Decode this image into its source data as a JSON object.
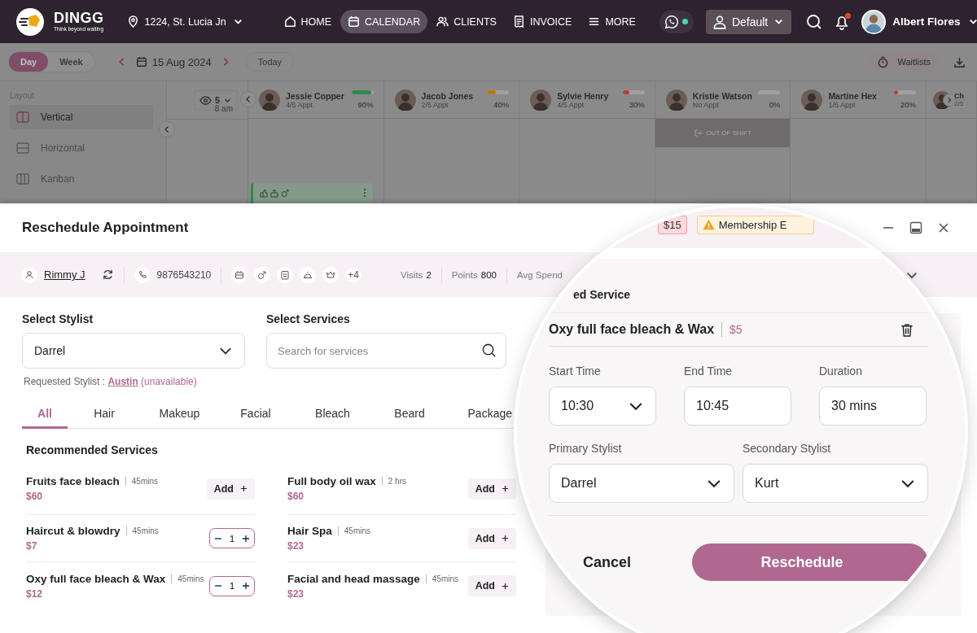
{
  "nav": {
    "brand": "DINGG",
    "tagline": "Think beyond waiting",
    "location": "1224, St. Lucia Jn",
    "items": [
      {
        "label": "HOME",
        "selected": false
      },
      {
        "label": "CALENDAR",
        "selected": true
      },
      {
        "label": "CLIENTS",
        "selected": false
      },
      {
        "label": "INVOICE",
        "selected": false
      },
      {
        "label": "MORE",
        "selected": false
      }
    ],
    "whatsapp_online": true,
    "profile": "Default",
    "notification_dot": true,
    "user": "Albert Flores"
  },
  "calendar": {
    "views": [
      {
        "label": "Day",
        "selected": true
      },
      {
        "label": "Week",
        "selected": false
      }
    ],
    "date": "15 Aug 2024",
    "today": "Today",
    "waitlists": "Waitlists",
    "layout_title": "Layout",
    "layouts": [
      {
        "label": "Vertical",
        "selected": true
      },
      {
        "label": "Horizontal",
        "selected": false
      },
      {
        "label": "Kanban",
        "selected": false
      }
    ],
    "visible_count": "5",
    "time": "8 am",
    "stylists": [
      {
        "name": "Jessie Copper",
        "appts": "4/5 Appt",
        "level": 0.9,
        "percent": "90%",
        "color": "#2f8a4a",
        "appointment": true
      },
      {
        "name": "Jacob Jones",
        "appts": "2/5 Appt",
        "level": 0.4,
        "percent": "40%",
        "color": "#b07a1a"
      },
      {
        "name": "Sylvie Henry",
        "appts": "4/5 Appt",
        "level": 0.3,
        "percent": "30%",
        "color": "#b5402c"
      },
      {
        "name": "Kristie Watson",
        "appts": "No Appt",
        "percent": "0%",
        "out_of_shift": "OUT OF SHIFT"
      },
      {
        "name": "Martine Hex",
        "appts": "1/5 Appt",
        "level": 0.2,
        "percent": "20%",
        "color": "#b5402c"
      },
      {
        "name": "Ch",
        "appts": "2/5"
      }
    ]
  },
  "modal": {
    "title": "Reschedule Appointment",
    "client": {
      "name": "Rimmy J",
      "phone": "9876543210",
      "extra": "+4",
      "stats": [
        {
          "label": "Visits",
          "value": "2"
        },
        {
          "label": "Points",
          "value": "800"
        },
        {
          "label": "Avg Spend"
        }
      ]
    },
    "stylist_label": "Select Stylist",
    "stylist": "Darrel",
    "services_label": "Select Services",
    "search_placeholder": "Search for services",
    "requested_label": "Requested Stylist :",
    "requested_name": "Austin",
    "requested_note": "(unavailable)",
    "tabs": [
      {
        "label": "All",
        "selected": true
      },
      {
        "label": "Hair",
        "selected": false
      },
      {
        "label": "Makeup",
        "selected": false
      },
      {
        "label": "Facial",
        "selected": false
      },
      {
        "label": "Bleach",
        "selected": false
      },
      {
        "label": "Beard",
        "selected": false
      },
      {
        "label": "Package",
        "selected": false
      }
    ],
    "recommended_title": "Recommended Services",
    "services": [
      {
        "name": "Fruits face bleach",
        "duration": "45mins",
        "price": "$60",
        "kind": "add",
        "action": "Add"
      },
      {
        "name": "Full body oil wax",
        "duration": "2 hrs",
        "price": "$60",
        "kind": "add",
        "action": "Add"
      },
      {
        "name": "Haircut & blowdry",
        "duration": "45mins",
        "price": "$7",
        "kind": "stepper",
        "quantity": "1"
      },
      {
        "name": "Hair Spa",
        "duration": "45mins",
        "price": "$23",
        "kind": "add",
        "action": "Add"
      },
      {
        "name": "Oxy full face bleach & Wax",
        "duration": "45mins",
        "price": "$12",
        "kind": "stepper",
        "quantity": "1"
      },
      {
        "name": "Facial and head massage",
        "duration": "45mins",
        "price": "$23",
        "kind": "add",
        "action": "Add"
      }
    ]
  },
  "magnifier": {
    "badges": [
      {
        "text": "$15",
        "kind": "danger"
      },
      {
        "text": "Membership E",
        "kind": "warning"
      }
    ],
    "section_title": "ed Service",
    "service_name": "Oxy full face bleach & Wax",
    "service_price": "$5",
    "start_label": "Start Time",
    "start": "10:30",
    "end_label": "End Time",
    "end": "10:45",
    "duration_label": "Duration",
    "duration": "30 mins",
    "primary_label": "Primary Stylist",
    "primary": "Darrel",
    "secondary_label": "Secondary Stylist",
    "secondary": "Kurt",
    "cancel": "Cancel",
    "submit": "Reschedule"
  }
}
